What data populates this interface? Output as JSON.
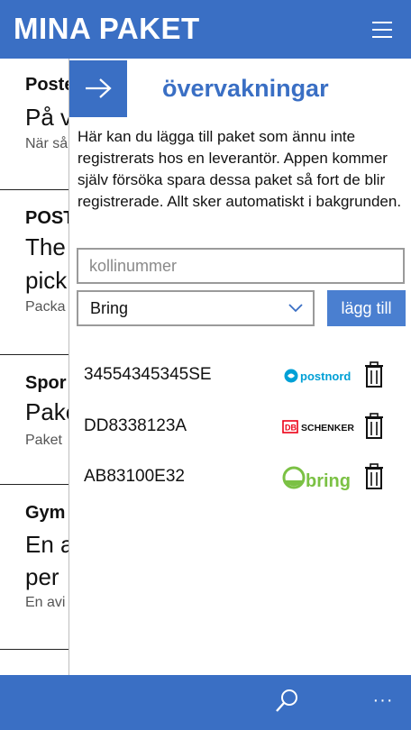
{
  "header": {
    "title": "MINA PAKET",
    "menu_icon": "hamburger-icon"
  },
  "packages": [
    {
      "name": "Poste",
      "status": "På v",
      "sub": "När så"
    },
    {
      "name": "POST",
      "status": "The",
      "status2": "pick",
      "sub": "Packa"
    },
    {
      "name": "Spor",
      "status": "Pake",
      "sub": "Paket"
    },
    {
      "name": "Gym",
      "status": "En a",
      "status2": "per",
      "sub": "En avi"
    }
  ],
  "panel": {
    "back_icon": "arrow-right-icon",
    "title": "övervakningar",
    "description": "Här kan du lägga till paket som ännu inte registrerats hos en leverantör. Appen kommer själv försöka spara dessa paket så fort de blir registrerade. Allt sker automatiskt i bakgrunden.",
    "input": {
      "placeholder": "kollinummer",
      "value": ""
    },
    "carrier_select": {
      "selected": "Bring"
    },
    "add_button": "lägg till",
    "parcels": [
      {
        "number": "34554345345SE",
        "carrier": "postnord",
        "carrier_logo_text": "postnord",
        "carrier_color": "#00a0d6"
      },
      {
        "number": "DD8338123A",
        "carrier": "schenker",
        "carrier_logo_prefix": "DB",
        "carrier_logo_text": "SCHENKER",
        "carrier_color": "#ec0016"
      },
      {
        "number": "AB83100E32",
        "carrier": "bring",
        "carrier_logo_text": "bring",
        "carrier_color": "#7bc144"
      }
    ]
  },
  "appbar": {
    "search_icon": "search-icon",
    "more_label": "···"
  },
  "colors": {
    "accent": "#3a6fc4",
    "button": "#4a7fd0"
  }
}
